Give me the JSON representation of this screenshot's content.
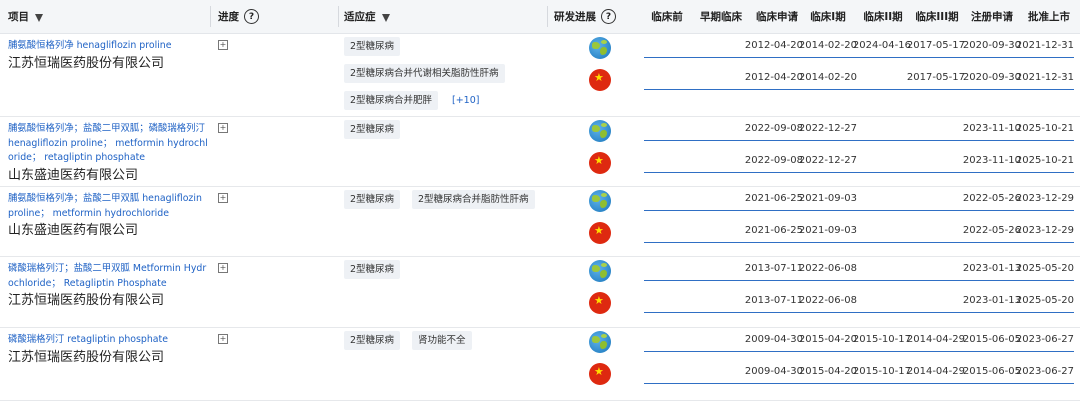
{
  "header": {
    "project": "项目",
    "progress": "进度",
    "indication": "适应症",
    "rd_progress": "研发进展",
    "help_glyph": "?",
    "phases": [
      "临床前",
      "早期临床",
      "临床申请",
      "临床I期",
      "临床II期",
      "临床III期",
      "注册申请",
      "批准上市"
    ]
  },
  "icons": {
    "expand": "+",
    "china_star": "★"
  },
  "rows": [
    {
      "drug": "脯氨酸恒格列净 henagliflozin proline",
      "company": "江苏恒瑞医药股份有限公司",
      "indications": [
        "2型糖尿病",
        "2型糖尿病合并代谢相关脂肪性肝病",
        "2型糖尿病合并肥胖"
      ],
      "more": "[+10]",
      "progress": [
        {
          "region": "globe",
          "dates": [
            "",
            "",
            "2012-04-20",
            "2014-02-20",
            "2024-04-16",
            "2017-05-17",
            "2020-09-30",
            "2021-12-31"
          ]
        },
        {
          "region": "china",
          "dates": [
            "",
            "",
            "2012-04-20",
            "2014-02-20",
            "",
            "2017-05-17",
            "2020-09-30",
            "2021-12-31"
          ]
        }
      ]
    },
    {
      "drug": "脯氨酸恒格列净；盐酸二甲双胍；磷酸瑞格列汀 henagliflozin proline； metformin hydrochloride； retagliptin phosphate",
      "company": "山东盛迪医药有限公司",
      "indications": [
        "2型糖尿病"
      ],
      "more": "",
      "progress": [
        {
          "region": "globe",
          "dates": [
            "",
            "",
            "2022-09-08",
            "2022-12-27",
            "",
            "",
            "2023-11-10",
            "2025-10-21"
          ]
        },
        {
          "region": "china",
          "dates": [
            "",
            "",
            "2022-09-08",
            "2022-12-27",
            "",
            "",
            "2023-11-10",
            "2025-10-21"
          ]
        }
      ]
    },
    {
      "drug": "脯氨酸恒格列净；盐酸二甲双胍 henagliflozin proline； metformin hydrochloride",
      "company": "山东盛迪医药有限公司",
      "indications": [
        "2型糖尿病",
        "2型糖尿病合并脂肪性肝病"
      ],
      "more": "",
      "progress": [
        {
          "region": "globe",
          "dates": [
            "",
            "",
            "2021-06-25",
            "2021-09-03",
            "",
            "",
            "2022-05-26",
            "2023-12-29"
          ]
        },
        {
          "region": "china",
          "dates": [
            "",
            "",
            "2021-06-25",
            "2021-09-03",
            "",
            "",
            "2022-05-26",
            "2023-12-29"
          ]
        }
      ]
    },
    {
      "drug": "磷酸瑞格列汀；盐酸二甲双胍 Metformin Hydrochloride； Retagliptin Phosphate",
      "company": "江苏恒瑞医药股份有限公司",
      "indications": [
        "2型糖尿病"
      ],
      "more": "",
      "progress": [
        {
          "region": "globe",
          "dates": [
            "",
            "",
            "2013-07-11",
            "2022-06-08",
            "",
            "",
            "2023-01-13",
            "2025-05-20"
          ]
        },
        {
          "region": "china",
          "dates": [
            "",
            "",
            "2013-07-11",
            "2022-06-08",
            "",
            "",
            "2023-01-13",
            "2025-05-20"
          ]
        }
      ]
    },
    {
      "drug": "磷酸瑞格列汀 retagliptin phosphate",
      "company": "江苏恒瑞医药股份有限公司",
      "indications": [
        "2型糖尿病",
        "肾功能不全"
      ],
      "more": "",
      "progress": [
        {
          "region": "globe",
          "dates": [
            "",
            "",
            "2009-04-30",
            "2015-04-20",
            "2015-10-17",
            "2014-04-29",
            "2015-06-05",
            "2023-06-27"
          ]
        },
        {
          "region": "china",
          "dates": [
            "",
            "",
            "2009-04-30",
            "2015-04-20",
            "2015-10-17",
            "2014-04-29",
            "2015-06-05",
            "2023-06-27"
          ]
        }
      ]
    }
  ]
}
